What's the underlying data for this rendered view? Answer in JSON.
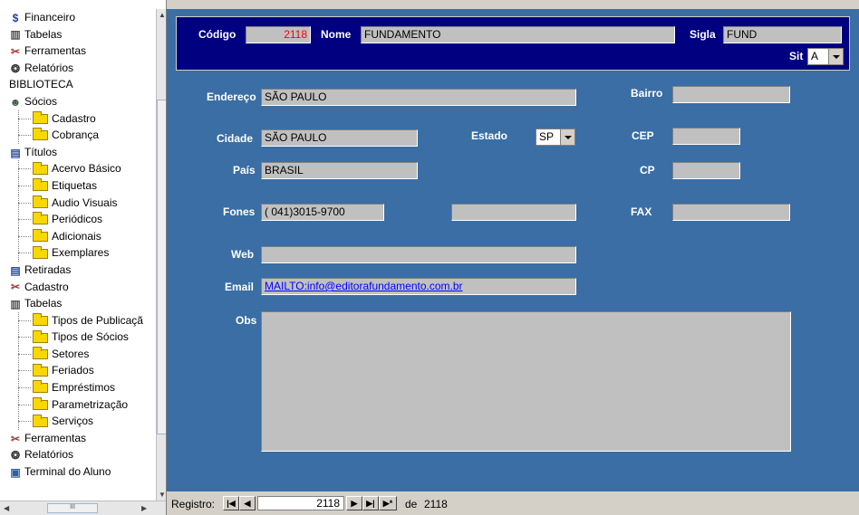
{
  "tree": {
    "items": [
      {
        "label": "Financeiro",
        "icon": "money-icon",
        "level": 0
      },
      {
        "label": "Tabelas",
        "icon": "building-icon",
        "level": 0
      },
      {
        "label": "Ferramentas",
        "icon": "tools-icon",
        "level": 0
      },
      {
        "label": "Relatórios",
        "icon": "report-icon",
        "level": 0
      },
      {
        "label": "BIBLIOTECA",
        "icon": "",
        "level": 0
      },
      {
        "label": "Sócios",
        "icon": "people-icon",
        "level": 0
      },
      {
        "label": "Cadastro",
        "icon": "folder-icon",
        "level": 1
      },
      {
        "label": "Cobrança",
        "icon": "folder-icon",
        "level": 1
      },
      {
        "label": "Títulos",
        "icon": "books-icon",
        "level": 0
      },
      {
        "label": "Acervo Básico",
        "icon": "open-folder-icon",
        "level": 1
      },
      {
        "label": "Etiquetas",
        "icon": "folder-icon",
        "level": 1
      },
      {
        "label": "Audio Visuais",
        "icon": "folder-icon",
        "level": 1
      },
      {
        "label": "Periódicos",
        "icon": "folder-icon",
        "level": 1
      },
      {
        "label": "Adicionais",
        "icon": "folder-icon",
        "level": 1
      },
      {
        "label": "Exemplares",
        "icon": "folder-icon",
        "level": 1
      },
      {
        "label": "Retiradas",
        "icon": "books-icon",
        "level": 0
      },
      {
        "label": "Cadastro",
        "icon": "tools-icon",
        "level": 0
      },
      {
        "label": "Tabelas",
        "icon": "building-icon",
        "level": 0
      },
      {
        "label": "Tipos de Publicaçã",
        "icon": "folder-icon",
        "level": 1
      },
      {
        "label": "Tipos de Sócios",
        "icon": "folder-icon",
        "level": 1
      },
      {
        "label": "Setores",
        "icon": "folder-icon",
        "level": 1
      },
      {
        "label": "Feriados",
        "icon": "folder-icon",
        "level": 1
      },
      {
        "label": "Empréstimos",
        "icon": "folder-icon",
        "level": 1
      },
      {
        "label": "Parametrização",
        "icon": "folder-icon",
        "level": 1
      },
      {
        "label": "Serviços",
        "icon": "folder-icon",
        "level": 1
      },
      {
        "label": "Ferramentas",
        "icon": "tools-icon",
        "level": 0
      },
      {
        "label": "Relatórios",
        "icon": "report-icon",
        "level": 0
      },
      {
        "label": "Terminal do Aluno",
        "icon": "computer-icon",
        "level": 0
      }
    ],
    "hscroll_grip": "III"
  },
  "header": {
    "codigo_label": "Código",
    "codigo_value": "2118",
    "nome_label": "Nome",
    "nome_value": "FUNDAMENTO",
    "sigla_label": "Sigla",
    "sigla_value": "FUND",
    "sit_label": "Sit",
    "sit_value": "A"
  },
  "form": {
    "endereco_label": "Endereço",
    "endereco_value": "SÃO PAULO",
    "bairro_label": "Bairro",
    "bairro_value": "",
    "cidade_label": "Cidade",
    "cidade_value": "SÃO PAULO",
    "estado_label": "Estado",
    "estado_value": "SP",
    "cep_label": "CEP",
    "cep_value": "",
    "pais_label": "País",
    "pais_value": "BRASIL",
    "cp_label": "CP",
    "cp_value": "",
    "fones_label": "Fones",
    "fones_value": "( 041)3015-9700",
    "fones2_value": "",
    "fax_label": "FAX",
    "fax_value": "",
    "web_label": "Web",
    "web_value": "",
    "email_label": "Email",
    "email_value": "MAILTO:info@editorafundamento.com.br",
    "obs_label": "Obs",
    "obs_value": ""
  },
  "nav": {
    "registro_label": "Registro:",
    "current": "2118",
    "de_label": "de",
    "total": "2118",
    "first_symbol": "|◀",
    "prev_symbol": "◀",
    "next_symbol": "▶",
    "last_symbol": "▶|",
    "new_symbol": "▶*"
  },
  "colors": {
    "form_bg": "#3a6ea5",
    "header_bg": "#000080",
    "code_text": "#ff0000",
    "link_text": "#0000ff"
  }
}
